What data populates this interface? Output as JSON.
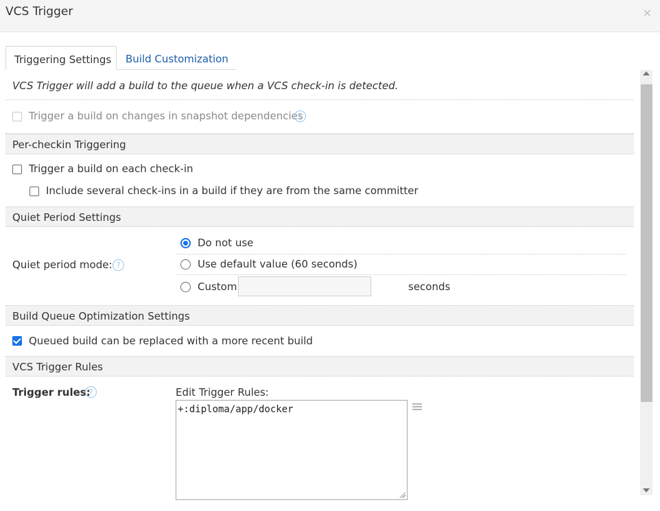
{
  "dialog": {
    "title": "VCS Trigger",
    "close_icon": "×"
  },
  "tabs": [
    {
      "label": "Triggering Settings",
      "active": true
    },
    {
      "label": "Build Customization",
      "active": false
    }
  ],
  "intro": "VCS Trigger will add a build to the queue when a VCS check-in is detected.",
  "snapshot": {
    "label": "Trigger a build on changes in snapshot dependencies",
    "checked": false,
    "disabled": true,
    "help_icon": "?"
  },
  "per_checkin": {
    "header": "Per-checkin Triggering",
    "each_checkin_label": "Trigger a build on each check-in",
    "each_checkin_checked": false,
    "several_label": "Include several check-ins in a build if they are from the same committer",
    "several_checked": false
  },
  "quiet_period": {
    "header": "Quiet Period Settings",
    "mode_label": "Quiet period mode:",
    "help_icon": "?",
    "options": [
      {
        "label": "Do not use",
        "selected": true
      },
      {
        "label": "Use default value (60 seconds)",
        "selected": false
      },
      {
        "label": "Custom",
        "selected": false
      }
    ],
    "custom_value": "",
    "seconds_label": "seconds"
  },
  "queue_opt": {
    "header": "Build Queue Optimization Settings",
    "replace_label": "Queued build can be replaced with a more recent build",
    "replace_checked": true
  },
  "rules": {
    "header": "VCS Trigger Rules",
    "label": "Trigger rules:",
    "help_icon": "?",
    "edit_label": "Edit Trigger Rules:",
    "value": "+:diploma/app/docker"
  },
  "colors": {
    "accent": "#1a73e8",
    "link": "#1d5ea8",
    "section_bg": "#f2f2f2"
  }
}
